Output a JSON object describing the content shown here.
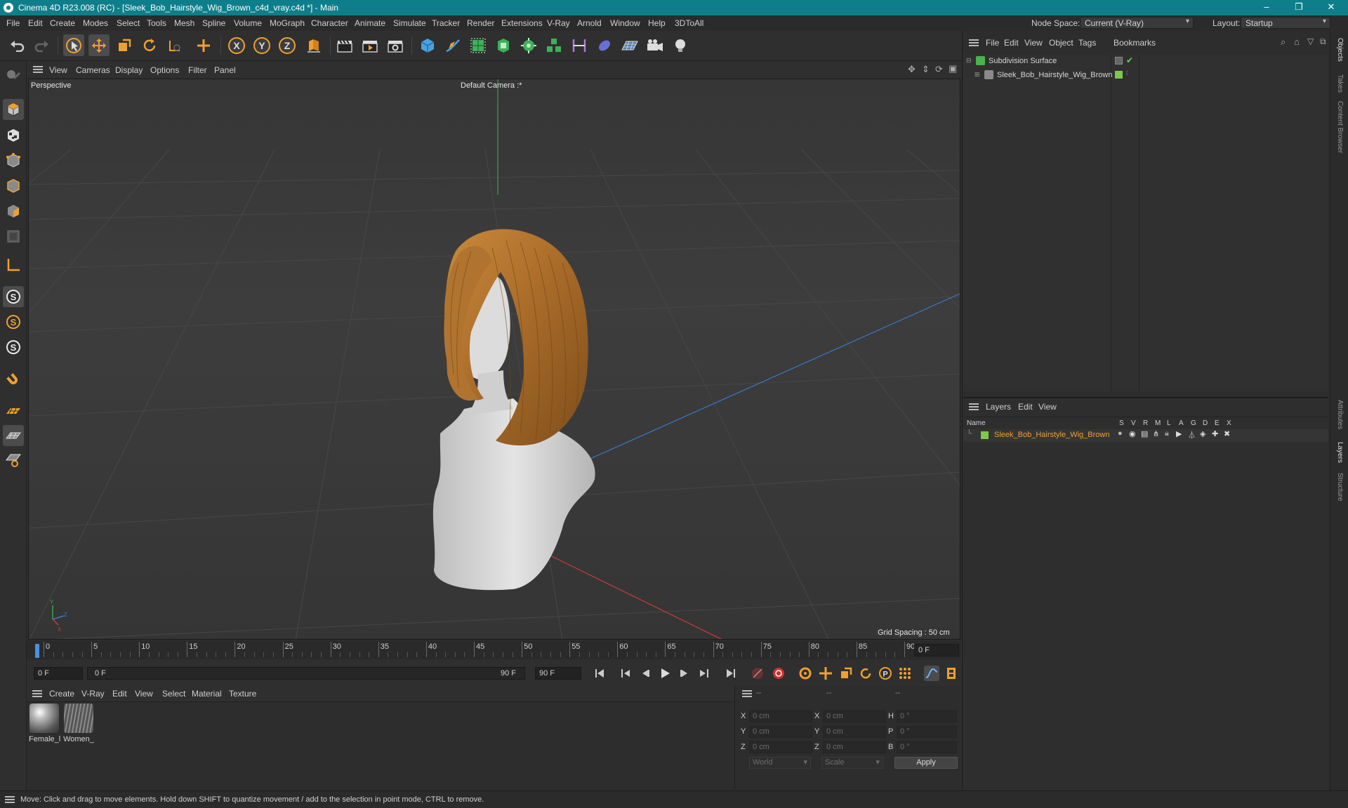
{
  "window": {
    "title": "Cinema 4D R23.008 (RC) - [Sleek_Bob_Hairstyle_Wig_Brown_c4d_vray.c4d *] - Main",
    "controls": [
      "–",
      "❐",
      "✕"
    ]
  },
  "menubar": {
    "items": [
      "File",
      "Edit",
      "Create",
      "Modes",
      "Select",
      "Tools",
      "Mesh",
      "Spline",
      "Volume",
      "MoGraph",
      "Character",
      "Animate",
      "Simulate",
      "Tracker",
      "Render",
      "Extensions",
      "V-Ray",
      "Arnold",
      "Window",
      "Help",
      "3DToAll"
    ],
    "node_space_label": "Node Space:",
    "node_space_value": "Current (V-Ray)",
    "layout_label": "Layout:",
    "layout_value": "Startup"
  },
  "viewport": {
    "menu": [
      "View",
      "Cameras",
      "Display",
      "Options",
      "Filter",
      "Panel"
    ],
    "view_name": "Perspective",
    "camera": "Default Camera :*",
    "grid_spacing": "Grid Spacing : 50 cm",
    "axis_labels": {
      "y": "Y",
      "z": "Z",
      "x": "X"
    }
  },
  "timeline": {
    "ticks": [
      "0",
      "5",
      "10",
      "15",
      "20",
      "25",
      "30",
      "35",
      "40",
      "45",
      "50",
      "55",
      "60",
      "65",
      "70",
      "75",
      "80",
      "85",
      "90"
    ],
    "current_frame_field": "0 F",
    "start_field": "0 F",
    "range_start": "0 F",
    "range_end": "90 F",
    "end_field": "90 F",
    "max_field": "90 F"
  },
  "materials": {
    "menu": [
      "Create",
      "V-Ray",
      "Edit",
      "View",
      "Select",
      "Material",
      "Texture"
    ],
    "items": [
      {
        "name": "Female_l"
      },
      {
        "name": "Women_"
      }
    ]
  },
  "coordinates": {
    "headers": [
      "--",
      "--",
      "--"
    ],
    "rows": [
      {
        "axis": "X",
        "pos": "0 cm",
        "axis2": "X",
        "size": "0 cm",
        "rot_label": "H",
        "rot": "0 °"
      },
      {
        "axis": "Y",
        "pos": "0 cm",
        "axis2": "Y",
        "size": "0 cm",
        "rot_label": "P",
        "rot": "0 °"
      },
      {
        "axis": "Z",
        "pos": "0 cm",
        "axis2": "Z",
        "size": "0 cm",
        "rot_label": "B",
        "rot": "0 °"
      }
    ],
    "mode_world": "World",
    "mode_scale": "Scale",
    "apply": "Apply"
  },
  "objects": {
    "menu": [
      "File",
      "Edit",
      "View",
      "Object",
      "Tags",
      "Bookmarks"
    ],
    "items": [
      {
        "name": "Subdivision Surface",
        "color": "#4ab34a"
      },
      {
        "name": "Sleek_Bob_Hairstyle_Wig_Brown",
        "color": "#7ec84c"
      }
    ]
  },
  "layers": {
    "menu": [
      "Layers",
      "Edit",
      "View"
    ],
    "name_header": "Name",
    "flag_headers": [
      "S",
      "V",
      "R",
      "M",
      "L",
      "A",
      "G",
      "D",
      "E",
      "X"
    ],
    "items": [
      {
        "name": "Sleek_Bob_Hairstyle_Wig_Brown",
        "color": "#7ec84c"
      }
    ]
  },
  "side_tabs": [
    "Objects",
    "Takes",
    "Content Browser",
    "Attributes",
    "Layers",
    "Structure"
  ],
  "status": {
    "text": "Move: Click and drag to move elements. Hold down SHIFT to quantize movement / add to the selection in point mode, CTRL to remove."
  },
  "colors": {
    "titlebar": "#0e7f8a",
    "accent_orange": "#f0a030",
    "layer_name_orange": "#f0a030",
    "hair_brown": "#b7782f",
    "bust_white": "#d9d9d9"
  }
}
